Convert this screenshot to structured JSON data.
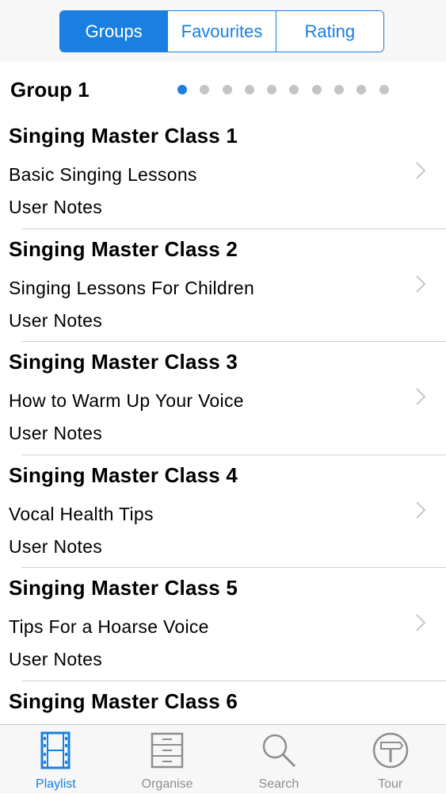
{
  "segments": [
    {
      "label": "Groups",
      "active": true
    },
    {
      "label": "Favourites",
      "active": false
    },
    {
      "label": "Rating",
      "active": false
    }
  ],
  "group": {
    "title": "Group 1",
    "page_count": 10,
    "current_page": 1
  },
  "items": [
    {
      "title": "Singing Master Class 1",
      "subtitle": "Basic Singing Lessons",
      "notes": "User Notes"
    },
    {
      "title": "Singing Master Class 2",
      "subtitle": "Singing Lessons For Children",
      "notes": "User Notes"
    },
    {
      "title": "Singing Master Class 3",
      "subtitle": "How to Warm Up Your Voice",
      "notes": "User Notes"
    },
    {
      "title": "Singing Master Class 4",
      "subtitle": "Vocal Health Tips",
      "notes": "User Notes"
    },
    {
      "title": "Singing Master Class 5",
      "subtitle": "Tips For a Hoarse Voice",
      "notes": "User Notes"
    },
    {
      "title": "Singing Master Class 6",
      "subtitle": "",
      "notes": ""
    }
  ],
  "tabs": [
    {
      "label": "Playlist",
      "icon": "film-strip-icon",
      "active": true
    },
    {
      "label": "Organise",
      "icon": "filing-cabinet-icon",
      "active": false
    },
    {
      "label": "Search",
      "icon": "magnifier-icon",
      "active": false
    },
    {
      "label": "Tour",
      "icon": "signpost-icon",
      "active": false
    }
  ],
  "colors": {
    "accent": "#1a7fe0",
    "inactive": "#8e8e8e",
    "separator": "#d0d0d0",
    "bar_background": "#f7f7f7"
  }
}
